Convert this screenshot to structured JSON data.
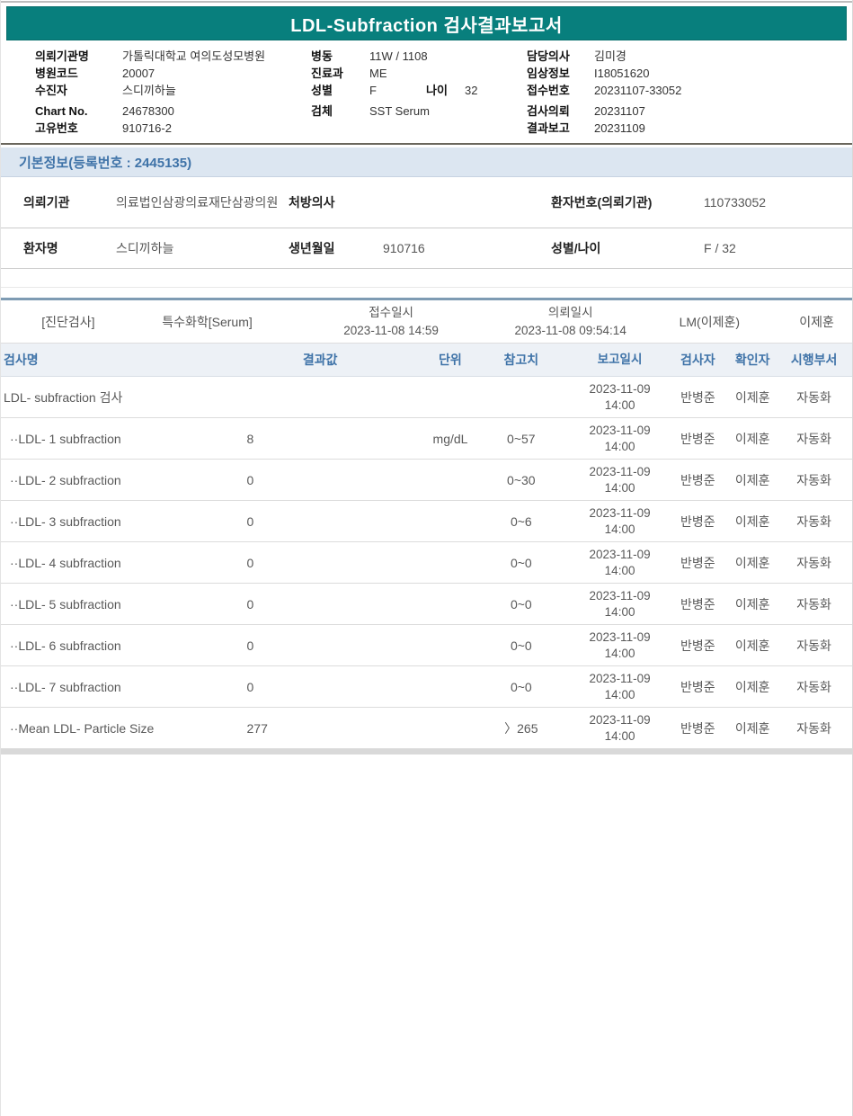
{
  "report": {
    "title": "LDL-Subfraction 검사결과보고서"
  },
  "colors": {
    "title_bar_bg": "#087f7d",
    "accent_blue": "#3f73a8",
    "info_bar_bg": "#dce6f1",
    "section_divider": "#7e9bb3"
  },
  "header_info": {
    "left": [
      {
        "label": "의뢰기관명",
        "value": "가톨릭대학교 여의도성모병원"
      },
      {
        "label": "병원코드",
        "value": "20007"
      },
      {
        "label": "수진자",
        "value": "스디끼하늘"
      },
      {
        "label": "Chart No.",
        "value": "24678300"
      },
      {
        "label": "고유번호",
        "value": "910716-2"
      }
    ],
    "middle": [
      {
        "label": "병동",
        "value": "11W / 1108"
      },
      {
        "label": "진료과",
        "value": "ME"
      },
      {
        "label": "성별",
        "value": "F",
        "label2": "나이",
        "value2": "32"
      },
      {
        "label": "검체",
        "value": "SST Serum"
      }
    ],
    "right": [
      {
        "label": "담당의사",
        "value": "김미경"
      },
      {
        "label": "임상정보",
        "value": "I18051620"
      },
      {
        "label": "접수번호",
        "value": "20231107-33052"
      },
      {
        "label": "검사의뢰",
        "value": "20231107"
      },
      {
        "label": "결과보고",
        "value": "20231109"
      }
    ]
  },
  "basic_info": {
    "bar_title": "기본정보(등록번호 : 2445135)",
    "row1": [
      {
        "label": "의뢰기관",
        "value": "의료법인삼광의료재단삼광의원"
      },
      {
        "label": "처방의사",
        "value": ""
      },
      {
        "label": "환자번호(의뢰기관)",
        "value": "110733052"
      }
    ],
    "row2": [
      {
        "label": "환자명",
        "value": "스디끼하늘"
      },
      {
        "label": "생년월일",
        "value": "910716"
      },
      {
        "label": "성별/나이",
        "value": "F / 32"
      }
    ]
  },
  "section": {
    "category": "[진단검사]",
    "panel": "특수화학[Serum]",
    "receipt_label": "접수일시",
    "receipt_datetime": "2023-11-08 14:59",
    "request_label": "의뢰일시",
    "request_datetime": "2023-11-08 09:54:14",
    "lab": "LM(이제훈)",
    "approver": "이제훈"
  },
  "results": {
    "columns": [
      "검사명",
      "결과값",
      "단위",
      "참고치",
      "보고일시",
      "검사자",
      "확인자",
      "시행부서"
    ],
    "rows": [
      {
        "name": "LDL- subfraction 검사",
        "result": "",
        "unit": "",
        "ref": "",
        "date": "2023-11-09",
        "time": "14:00",
        "tester": "반병준",
        "verifier": "이제훈",
        "dept": "자동화"
      },
      {
        "name": "··LDL- 1 subfraction",
        "result": "8",
        "unit": "mg/dL",
        "ref": "0~57",
        "date": "2023-11-09",
        "time": "14:00",
        "tester": "반병준",
        "verifier": "이제훈",
        "dept": "자동화"
      },
      {
        "name": "··LDL- 2 subfraction",
        "result": "0",
        "unit": "",
        "ref": "0~30",
        "date": "2023-11-09",
        "time": "14:00",
        "tester": "반병준",
        "verifier": "이제훈",
        "dept": "자동화"
      },
      {
        "name": "··LDL- 3 subfraction",
        "result": "0",
        "unit": "",
        "ref": "0~6",
        "date": "2023-11-09",
        "time": "14:00",
        "tester": "반병준",
        "verifier": "이제훈",
        "dept": "자동화"
      },
      {
        "name": "··LDL- 4 subfraction",
        "result": "0",
        "unit": "",
        "ref": "0~0",
        "date": "2023-11-09",
        "time": "14:00",
        "tester": "반병준",
        "verifier": "이제훈",
        "dept": "자동화"
      },
      {
        "name": "··LDL- 5 subfraction",
        "result": "0",
        "unit": "",
        "ref": "0~0",
        "date": "2023-11-09",
        "time": "14:00",
        "tester": "반병준",
        "verifier": "이제훈",
        "dept": "자동화"
      },
      {
        "name": "··LDL- 6 subfraction",
        "result": "0",
        "unit": "",
        "ref": "0~0",
        "date": "2023-11-09",
        "time": "14:00",
        "tester": "반병준",
        "verifier": "이제훈",
        "dept": "자동화"
      },
      {
        "name": "··LDL- 7 subfraction",
        "result": "0",
        "unit": "",
        "ref": "0~0",
        "date": "2023-11-09",
        "time": "14:00",
        "tester": "반병준",
        "verifier": "이제훈",
        "dept": "자동화"
      },
      {
        "name": "··Mean LDL- Particle Size",
        "result": "277",
        "unit": "",
        "ref": "〉265",
        "date": "2023-11-09",
        "time": "14:00",
        "tester": "반병준",
        "verifier": "이제훈",
        "dept": "자동화"
      }
    ]
  }
}
